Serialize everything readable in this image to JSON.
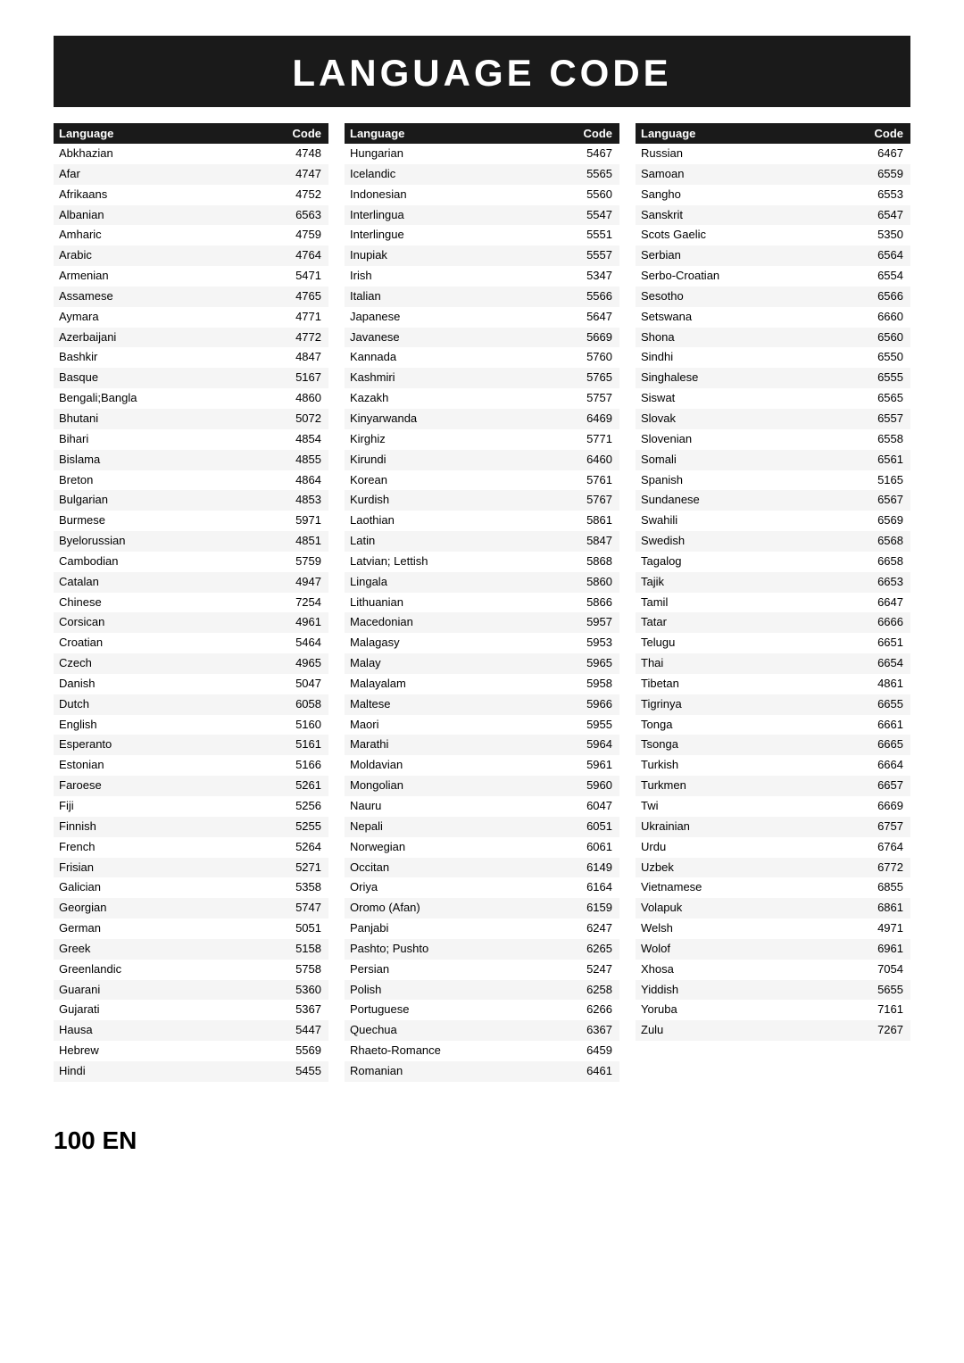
{
  "title": "LANGUAGE CODE",
  "columns": [
    {
      "header": {
        "lang": "Language",
        "code": "Code"
      },
      "rows": [
        {
          "lang": "Abkhazian",
          "code": "4748"
        },
        {
          "lang": "Afar",
          "code": "4747"
        },
        {
          "lang": "Afrikaans",
          "code": "4752"
        },
        {
          "lang": "Albanian",
          "code": "6563"
        },
        {
          "lang": "Amharic",
          "code": "4759"
        },
        {
          "lang": "Arabic",
          "code": "4764"
        },
        {
          "lang": "Armenian",
          "code": "5471"
        },
        {
          "lang": "Assamese",
          "code": "4765"
        },
        {
          "lang": "Aymara",
          "code": "4771"
        },
        {
          "lang": "Azerbaijani",
          "code": "4772"
        },
        {
          "lang": "Bashkir",
          "code": "4847"
        },
        {
          "lang": "Basque",
          "code": "5167"
        },
        {
          "lang": "Bengali;Bangla",
          "code": "4860"
        },
        {
          "lang": "Bhutani",
          "code": "5072"
        },
        {
          "lang": "Bihari",
          "code": "4854"
        },
        {
          "lang": "Bislama",
          "code": "4855"
        },
        {
          "lang": "Breton",
          "code": "4864"
        },
        {
          "lang": "Bulgarian",
          "code": "4853"
        },
        {
          "lang": "Burmese",
          "code": "5971"
        },
        {
          "lang": "Byelorussian",
          "code": "4851"
        },
        {
          "lang": "Cambodian",
          "code": "5759"
        },
        {
          "lang": "Catalan",
          "code": "4947"
        },
        {
          "lang": "Chinese",
          "code": "7254"
        },
        {
          "lang": "Corsican",
          "code": "4961"
        },
        {
          "lang": "Croatian",
          "code": "5464"
        },
        {
          "lang": "Czech",
          "code": "4965"
        },
        {
          "lang": "Danish",
          "code": "5047"
        },
        {
          "lang": "Dutch",
          "code": "6058"
        },
        {
          "lang": "English",
          "code": "5160"
        },
        {
          "lang": "Esperanto",
          "code": "5161"
        },
        {
          "lang": "Estonian",
          "code": "5166"
        },
        {
          "lang": "Faroese",
          "code": "5261"
        },
        {
          "lang": "Fiji",
          "code": "5256"
        },
        {
          "lang": "Finnish",
          "code": "5255"
        },
        {
          "lang": "French",
          "code": "5264"
        },
        {
          "lang": "Frisian",
          "code": "5271"
        },
        {
          "lang": "Galician",
          "code": "5358"
        },
        {
          "lang": "Georgian",
          "code": "5747"
        },
        {
          "lang": "German",
          "code": "5051"
        },
        {
          "lang": "Greek",
          "code": "5158"
        },
        {
          "lang": "Greenlandic",
          "code": "5758"
        },
        {
          "lang": "Guarani",
          "code": "5360"
        },
        {
          "lang": "Gujarati",
          "code": "5367"
        },
        {
          "lang": "Hausa",
          "code": "5447"
        },
        {
          "lang": "Hebrew",
          "code": "5569"
        },
        {
          "lang": "Hindi",
          "code": "5455"
        }
      ]
    },
    {
      "header": {
        "lang": "Language",
        "code": "Code"
      },
      "rows": [
        {
          "lang": "Hungarian",
          "code": "5467"
        },
        {
          "lang": "Icelandic",
          "code": "5565"
        },
        {
          "lang": "Indonesian",
          "code": "5560"
        },
        {
          "lang": "Interlingua",
          "code": "5547"
        },
        {
          "lang": "Interlingue",
          "code": "5551"
        },
        {
          "lang": "Inupiak",
          "code": "5557"
        },
        {
          "lang": "Irish",
          "code": "5347"
        },
        {
          "lang": "Italian",
          "code": "5566"
        },
        {
          "lang": "Japanese",
          "code": "5647"
        },
        {
          "lang": "Javanese",
          "code": "5669"
        },
        {
          "lang": "Kannada",
          "code": "5760"
        },
        {
          "lang": "Kashmiri",
          "code": "5765"
        },
        {
          "lang": "Kazakh",
          "code": "5757"
        },
        {
          "lang": "Kinyarwanda",
          "code": "6469"
        },
        {
          "lang": "Kirghiz",
          "code": "5771"
        },
        {
          "lang": "Kirundi",
          "code": "6460"
        },
        {
          "lang": "Korean",
          "code": "5761"
        },
        {
          "lang": "Kurdish",
          "code": "5767"
        },
        {
          "lang": "Laothian",
          "code": "5861"
        },
        {
          "lang": "Latin",
          "code": "5847"
        },
        {
          "lang": "Latvian; Lettish",
          "code": "5868"
        },
        {
          "lang": "Lingala",
          "code": "5860"
        },
        {
          "lang": "Lithuanian",
          "code": "5866"
        },
        {
          "lang": "Macedonian",
          "code": "5957"
        },
        {
          "lang": "Malagasy",
          "code": "5953"
        },
        {
          "lang": "Malay",
          "code": "5965"
        },
        {
          "lang": "Malayalam",
          "code": "5958"
        },
        {
          "lang": "Maltese",
          "code": "5966"
        },
        {
          "lang": "Maori",
          "code": "5955"
        },
        {
          "lang": "Marathi",
          "code": "5964"
        },
        {
          "lang": "Moldavian",
          "code": "5961"
        },
        {
          "lang": "Mongolian",
          "code": "5960"
        },
        {
          "lang": "Nauru",
          "code": "6047"
        },
        {
          "lang": "Nepali",
          "code": "6051"
        },
        {
          "lang": "Norwegian",
          "code": "6061"
        },
        {
          "lang": "Occitan",
          "code": "6149"
        },
        {
          "lang": "Oriya",
          "code": "6164"
        },
        {
          "lang": "Oromo (Afan)",
          "code": "6159"
        },
        {
          "lang": "Panjabi",
          "code": "6247"
        },
        {
          "lang": "Pashto; Pushto",
          "code": "6265"
        },
        {
          "lang": "Persian",
          "code": "5247"
        },
        {
          "lang": "Polish",
          "code": "6258"
        },
        {
          "lang": "Portuguese",
          "code": "6266"
        },
        {
          "lang": "Quechua",
          "code": "6367"
        },
        {
          "lang": "Rhaeto-Romance",
          "code": "6459"
        },
        {
          "lang": "Romanian",
          "code": "6461"
        }
      ]
    },
    {
      "header": {
        "lang": "Language",
        "code": "Code"
      },
      "rows": [
        {
          "lang": "Russian",
          "code": "6467"
        },
        {
          "lang": "Samoan",
          "code": "6559"
        },
        {
          "lang": "Sangho",
          "code": "6553"
        },
        {
          "lang": "Sanskrit",
          "code": "6547"
        },
        {
          "lang": "Scots Gaelic",
          "code": "5350"
        },
        {
          "lang": "Serbian",
          "code": "6564"
        },
        {
          "lang": "Serbo-Croatian",
          "code": "6554"
        },
        {
          "lang": "Sesotho",
          "code": "6566"
        },
        {
          "lang": "Setswana",
          "code": "6660"
        },
        {
          "lang": "Shona",
          "code": "6560"
        },
        {
          "lang": "Sindhi",
          "code": "6550"
        },
        {
          "lang": "Singhalese",
          "code": "6555"
        },
        {
          "lang": "Siswat",
          "code": "6565"
        },
        {
          "lang": "Slovak",
          "code": "6557"
        },
        {
          "lang": "Slovenian",
          "code": "6558"
        },
        {
          "lang": "Somali",
          "code": "6561"
        },
        {
          "lang": "Spanish",
          "code": "5165"
        },
        {
          "lang": "Sundanese",
          "code": "6567"
        },
        {
          "lang": "Swahili",
          "code": "6569"
        },
        {
          "lang": "Swedish",
          "code": "6568"
        },
        {
          "lang": "Tagalog",
          "code": "6658"
        },
        {
          "lang": "Tajik",
          "code": "6653"
        },
        {
          "lang": "Tamil",
          "code": "6647"
        },
        {
          "lang": "Tatar",
          "code": "6666"
        },
        {
          "lang": "Telugu",
          "code": "6651"
        },
        {
          "lang": "Thai",
          "code": "6654"
        },
        {
          "lang": "Tibetan",
          "code": "4861"
        },
        {
          "lang": "Tigrinya",
          "code": "6655"
        },
        {
          "lang": "Tonga",
          "code": "6661"
        },
        {
          "lang": "Tsonga",
          "code": "6665"
        },
        {
          "lang": "Turkish",
          "code": "6664"
        },
        {
          "lang": "Turkmen",
          "code": "6657"
        },
        {
          "lang": "Twi",
          "code": "6669"
        },
        {
          "lang": "Ukrainian",
          "code": "6757"
        },
        {
          "lang": "Urdu",
          "code": "6764"
        },
        {
          "lang": "Uzbek",
          "code": "6772"
        },
        {
          "lang": "Vietnamese",
          "code": "6855"
        },
        {
          "lang": "Volapuk",
          "code": "6861"
        },
        {
          "lang": "Welsh",
          "code": "4971"
        },
        {
          "lang": "Wolof",
          "code": "6961"
        },
        {
          "lang": "Xhosa",
          "code": "7054"
        },
        {
          "lang": "Yiddish",
          "code": "5655"
        },
        {
          "lang": "Yoruba",
          "code": "7161"
        },
        {
          "lang": "Zulu",
          "code": "7267"
        }
      ]
    }
  ],
  "footer": "100  EN"
}
